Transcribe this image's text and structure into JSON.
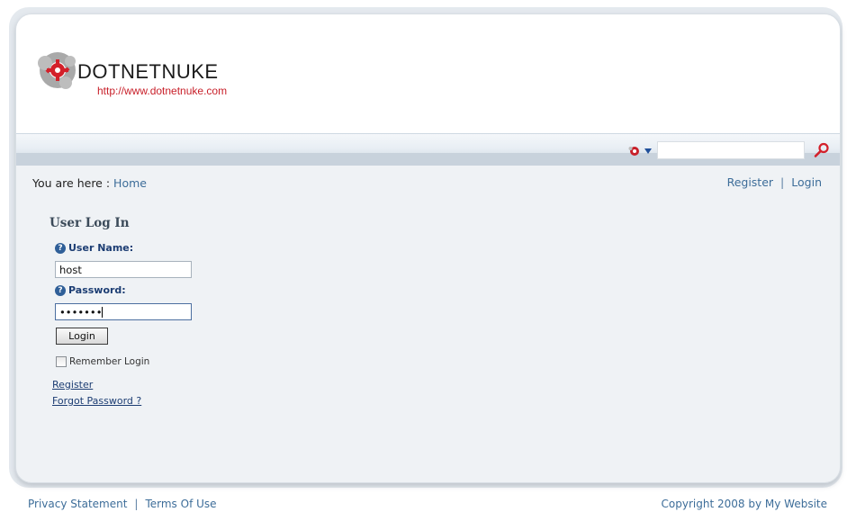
{
  "header": {
    "logo_name": "DOTNETNUKE",
    "logo_url": "http://www.dotnetnuke.com",
    "logo_icon": "dotnetnuke-gear-logo-icon"
  },
  "search": {
    "engine_icon": "web-search-engine-icon",
    "value": "",
    "submit_icon": "magnifier-search-icon"
  },
  "breadcrumb": {
    "prefix": "You are here :",
    "current": "Home"
  },
  "user_links": {
    "register": "Register",
    "separator": "|",
    "login": "Login"
  },
  "login_form": {
    "title": "User Log In",
    "help_icon": "help-question-icon",
    "username_label": "User Name:",
    "username_value": "host",
    "password_label": "Password:",
    "password_value": "•••••••",
    "login_button": "Login",
    "remember_label": "Remember Login",
    "remember_checked": false,
    "register_link": "Register",
    "forgot_link": "Forgot Password ?"
  },
  "footer": {
    "privacy": "Privacy Statement",
    "separator": "|",
    "terms": "Terms Of Use",
    "copyright": "Copyright 2008 by My Website"
  },
  "colors": {
    "brand_red": "#c8202a",
    "link_blue": "#3d6d99",
    "label_navy": "#1c3d73",
    "panel_bg": "#eff2f5"
  }
}
